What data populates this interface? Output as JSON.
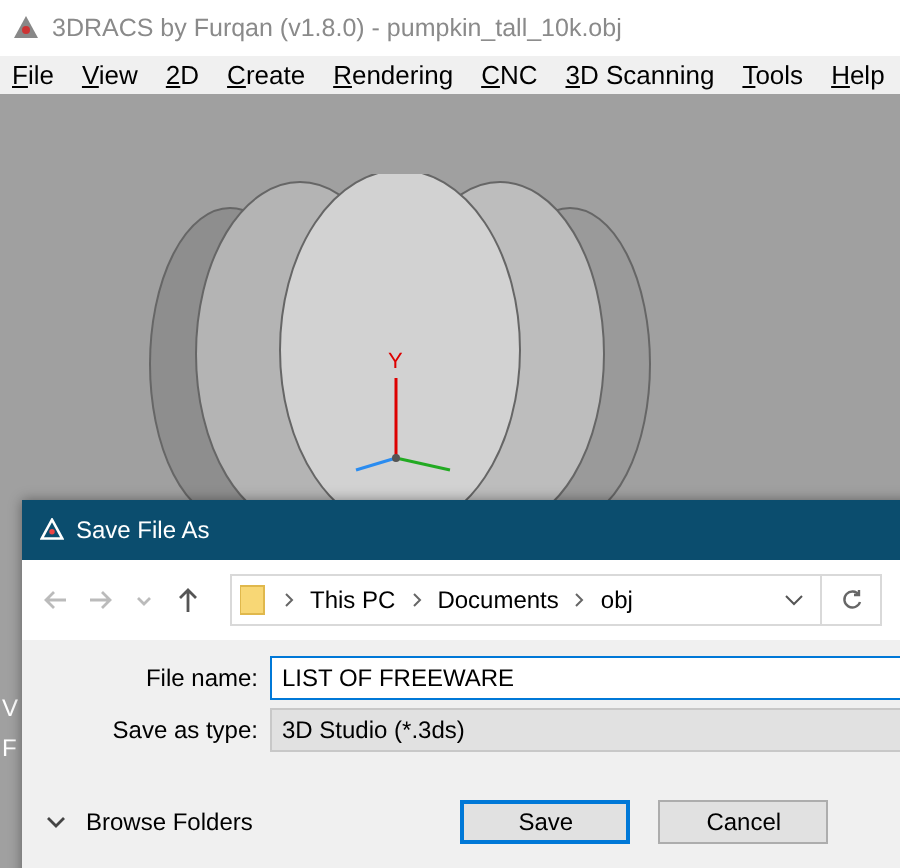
{
  "window": {
    "title": "3DRACS by Furqan (v1.8.0) - pumpkin_tall_10k.obj"
  },
  "menu": [
    "File",
    "View",
    "2D",
    "Create",
    "Rendering",
    "CNC",
    "3D Scanning",
    "Tools",
    "Help"
  ],
  "viewport": {
    "axis_label": "Y",
    "overlay_lines": [
      "V",
      "F"
    ]
  },
  "dialog": {
    "title": "Save File As",
    "path": [
      "This PC",
      "Documents",
      "obj"
    ],
    "fields": [
      {
        "label": "File name:",
        "value": "LIST OF FREEWARE",
        "kind": "input"
      },
      {
        "label": "Save as type:",
        "value": "3D Studio (*.3ds)",
        "kind": "select"
      }
    ],
    "browse": "Browse Folders",
    "buttons": [
      {
        "label": "Save",
        "default": true
      },
      {
        "label": "Cancel",
        "default": false
      }
    ]
  }
}
